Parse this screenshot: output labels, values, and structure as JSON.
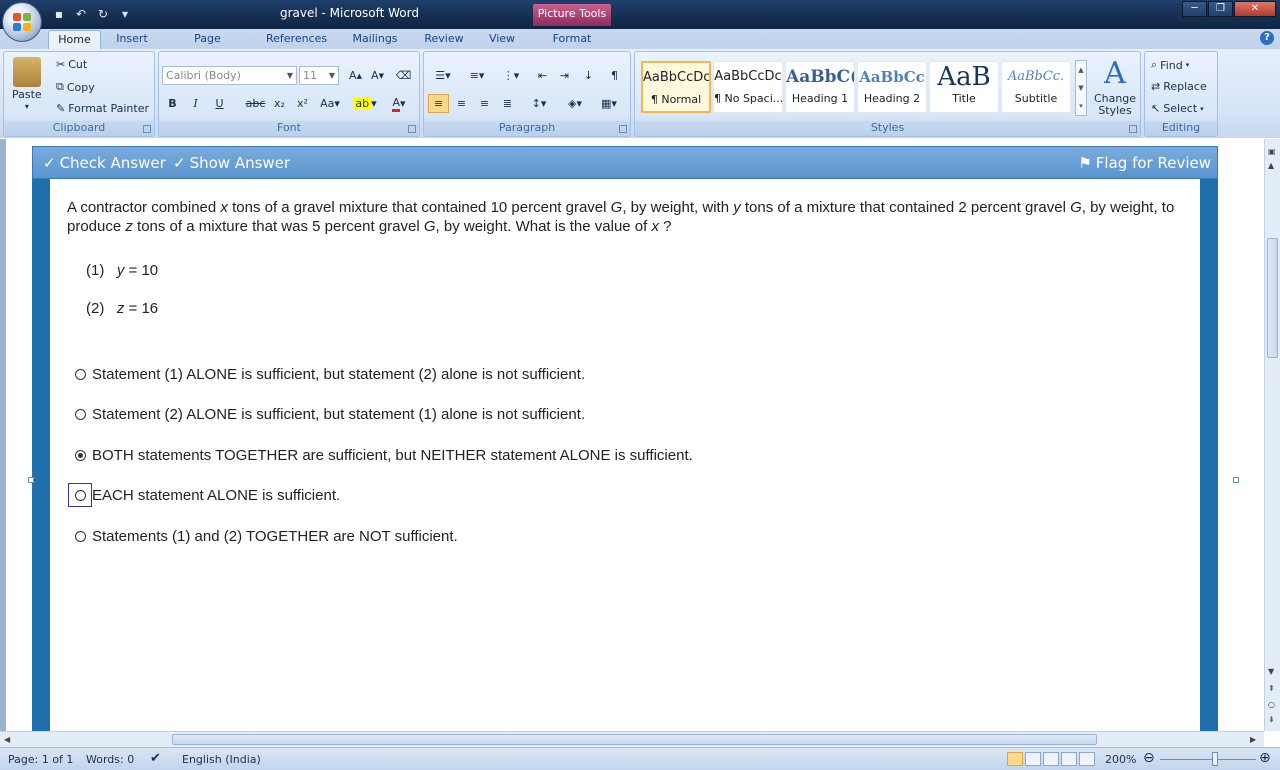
{
  "window": {
    "title": "gravel - Microsoft Word",
    "context_tab": "Picture Tools",
    "controls": [
      "minimize",
      "restore",
      "close"
    ]
  },
  "qat": [
    "save-icon",
    "undo-icon",
    "redo-icon",
    "customize-icon"
  ],
  "tabs": [
    "Home",
    "Insert",
    "Page Layout",
    "References",
    "Mailings",
    "Review",
    "View",
    "Format"
  ],
  "active_tab": "Home",
  "ribbon": {
    "clipboard": {
      "label": "Clipboard",
      "paste": "Paste",
      "cut": "Cut",
      "copy": "Copy",
      "format_painter": "Format Painter"
    },
    "font": {
      "label": "Font",
      "font_name": "Calibri (Body)",
      "font_size": "11"
    },
    "paragraph": {
      "label": "Paragraph"
    },
    "styles": {
      "label": "Styles",
      "items": [
        {
          "sample": "AaBbCcDc",
          "name": "¶ Normal"
        },
        {
          "sample": "AaBbCcDc",
          "name": "¶ No Spaci..."
        },
        {
          "sample": "AaBbC(",
          "name": "Heading 1"
        },
        {
          "sample": "AaBbCc",
          "name": "Heading 2"
        },
        {
          "sample": "AaB",
          "name": "Title"
        },
        {
          "sample": "AaBbCc.",
          "name": "Subtitle"
        }
      ],
      "change_styles": "Change Styles"
    },
    "editing": {
      "label": "Editing",
      "find": "Find",
      "replace": "Replace",
      "select": "Select"
    }
  },
  "toolbar": {
    "check_answer": "Check Answer",
    "show_answer": "Show Answer",
    "flag": "Flag for Review"
  },
  "question": {
    "part1": "A contractor combined ",
    "var_x": "x",
    "part2": " tons of a gravel mixture that contained 10 percent gravel ",
    "var_g1": "G",
    "part3": ", by weight, with ",
    "var_y": "y",
    "part4": " tons of a mixture that contained 2 percent gravel ",
    "var_g2": "G",
    "part5": ", by weight, to produce ",
    "var_z": "z",
    "part6": " tons of a mixture that was 5 percent gravel ",
    "var_g3": "G",
    "part7": ", by weight.  What is the value of ",
    "var_x2": "x",
    "part8": " ?"
  },
  "statements": [
    {
      "num": "(1)",
      "var": "y",
      "rest": " = 10"
    },
    {
      "num": "(2)",
      "var": "z",
      "rest": " = 16"
    }
  ],
  "options": [
    "Statement (1) ALONE is sufficient, but statement (2) alone is not sufficient.",
    "Statement (2) ALONE is sufficient, but statement (1) alone is not sufficient.",
    "BOTH statements TOGETHER are sufficient, but NEITHER statement ALONE is sufficient.",
    "EACH statement ALONE is sufficient.",
    "Statements (1) and (2) TOGETHER are NOT sufficient."
  ],
  "selected_option": 3,
  "status": {
    "page": "Page: 1 of 1",
    "words": "Words: 0",
    "language": "English (India)",
    "zoom": "200%"
  }
}
